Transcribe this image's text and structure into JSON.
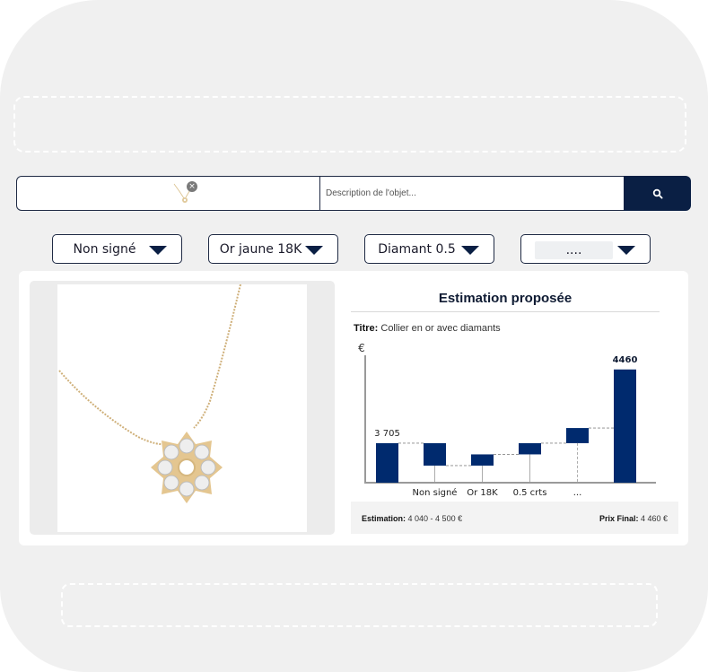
{
  "search": {
    "description_placeholder": "Description de l'objet...",
    "image_remove_glyph": "×"
  },
  "filters": [
    {
      "value": "Non signé"
    },
    {
      "value": "Or jaune 18K"
    },
    {
      "value": "Diamant 0.5"
    },
    {
      "value": "...."
    }
  ],
  "estimation": {
    "heading": "Estimation proposée",
    "titre_label": "Titre:",
    "titre_value": "Collier en or avec diamants",
    "range_label": "Estimation:",
    "range_value": "4 040 - 4 500 €",
    "final_label": "Prix Final:",
    "final_value": "4 460 €"
  },
  "chart_data": {
    "type": "waterfall",
    "y_unit": "€",
    "start": {
      "label": "3 705",
      "value": 3705
    },
    "end": {
      "label": "4460",
      "value": 4460
    },
    "steps": [
      {
        "category": "Non signé",
        "delta": -230
      },
      {
        "category": "Or 18K",
        "delta": 115
      },
      {
        "category": "0.5 crts",
        "delta": 115
      },
      {
        "category": "...",
        "delta": 155
      }
    ],
    "bar_color": "#002a6e"
  },
  "colors": {
    "navy": "#0a1f44",
    "bar": "#002a6e"
  }
}
